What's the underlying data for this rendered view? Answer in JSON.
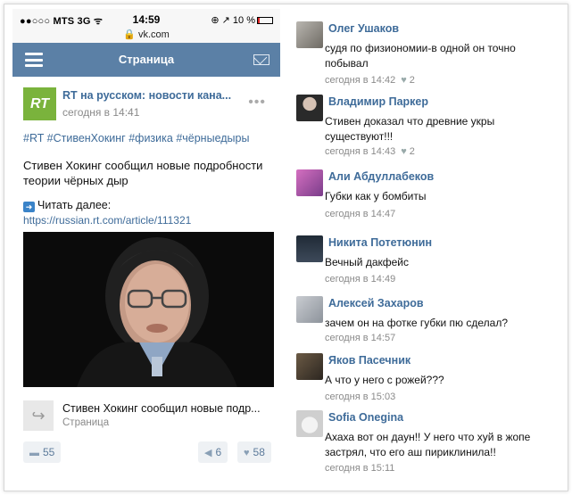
{
  "status_bar": {
    "carrier": "●●○○○ MTS  3G  ᯤ",
    "time": "14:59",
    "right": "⊕ ↗ 10 %",
    "url": "🔒 vk.com"
  },
  "header": {
    "title": "Страница"
  },
  "post": {
    "logo_text": "RT",
    "author": "RT на русском: новости кана...",
    "date": "сегодня в 14:41",
    "hashtags": "#RT #СтивенХокинг #физика #чёрныедыры",
    "text": "Стивен Хокинг сообщил новые подробности теории чёрных дыр",
    "readmore": "Читать далее:",
    "link": "https://russian.rt.com/article/111321",
    "share_title": "Стивен Хокинг сообщил новые подр...",
    "share_sub": "Страница",
    "comments_count": "55",
    "reposts_count": "6",
    "likes_count": "58"
  },
  "comments": [
    {
      "name": "Олег Ушаков",
      "text": "судя по физиономии-в одной он точно побывал",
      "time": "сегодня в 14:42",
      "likes": "2"
    },
    {
      "name": "Владимир Паркер",
      "text": "Стивен доказал что древние укры существуют!!!",
      "time": "сегодня в 14:43",
      "likes": "2"
    },
    {
      "name": "Али Абдуллабеков",
      "text": "Губки как у бомбиты",
      "time": "сегодня в 14:47",
      "likes": ""
    },
    {
      "name": "Никита Потетюнин",
      "text": "Вечный дакфейс",
      "time": "сегодня в 14:49",
      "likes": ""
    },
    {
      "name": "Алексей Захаров",
      "text": "зачем он на фотке губки пю сделал?",
      "time": "сегодня в 14:57",
      "likes": ""
    },
    {
      "name": "Яков Пасечник",
      "text": "А что у него с рожей???",
      "time": "сегодня в 15:03",
      "likes": ""
    },
    {
      "name": "Sofia Onegina",
      "text": "Ахаха вот он даун!! У него что хуй в жопе застрял, что его аш пириклинила!!",
      "time": "сегодня в 15:11",
      "likes": ""
    }
  ]
}
